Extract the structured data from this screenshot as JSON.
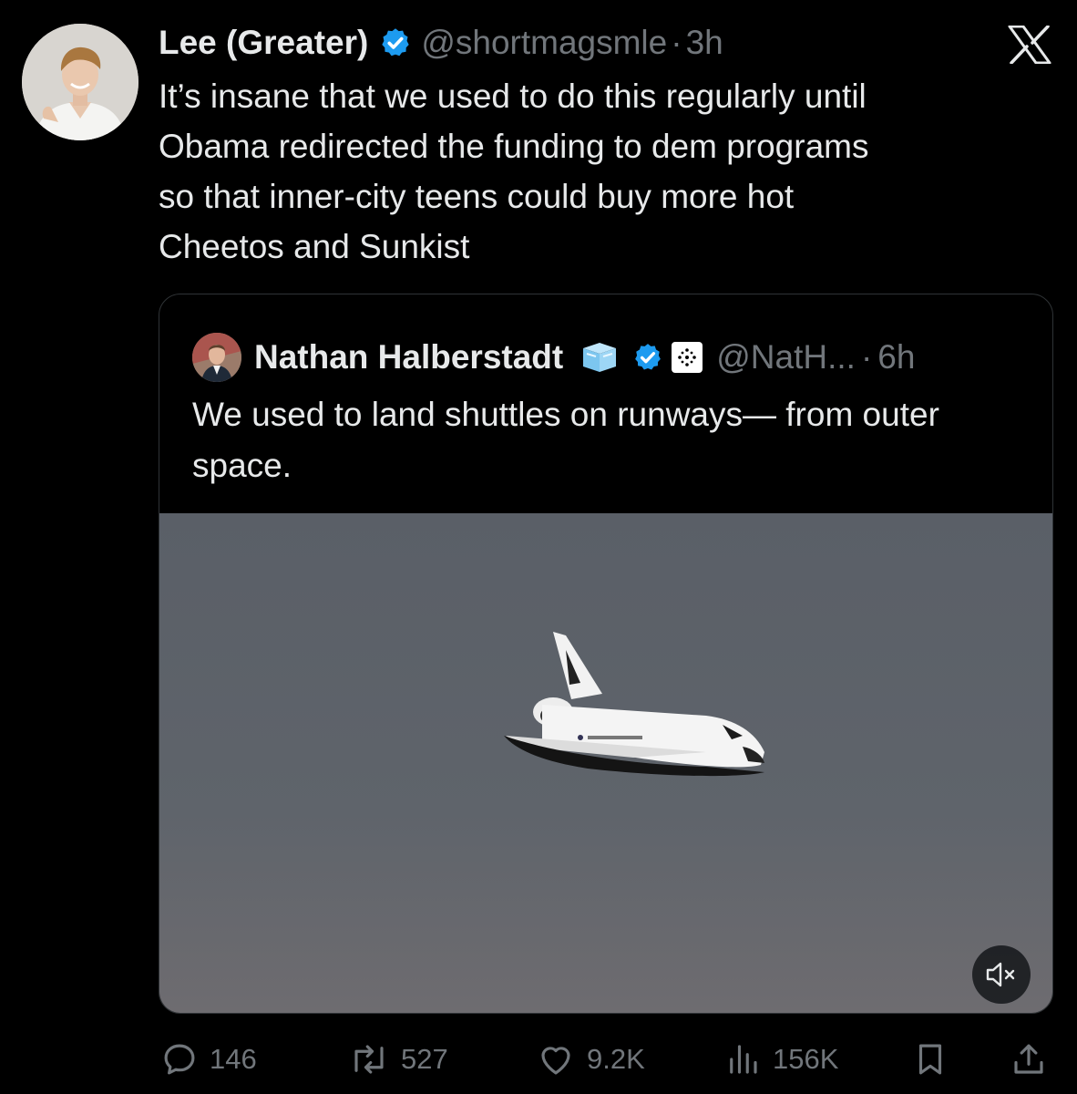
{
  "app": {
    "brand_icon": "x-logo-icon"
  },
  "tweet": {
    "author": {
      "name": "Lee (Greater)",
      "handle": "@shortmagsmle",
      "verified_color": "#1d9bf0"
    },
    "separator": "·",
    "time": "3h",
    "text": "It’s insane that we used to do this regularly until\nObama redirected the funding to dem programs\nso that inner-city teens could buy more hot\nCheetos and Sunkist"
  },
  "quoted": {
    "author": {
      "name": "Nathan Halberstadt",
      "handle": "@NatH...",
      "badges": [
        "ice-cube-emoji-icon",
        "verified-badge-icon",
        "organization-badge-icon"
      ]
    },
    "separator": "·",
    "time": "6h",
    "text": "We used to land shuttles on runways— from outer space.",
    "media": {
      "type": "video",
      "description_icon": "space-shuttle-image",
      "muted": true,
      "mute_icon": "speaker-muted-icon"
    }
  },
  "actions": {
    "reply": {
      "icon": "reply-icon",
      "count": "146"
    },
    "repost": {
      "icon": "repost-icon",
      "count": "527"
    },
    "like": {
      "icon": "heart-icon",
      "count": "9.2K"
    },
    "views": {
      "icon": "views-icon",
      "count": "156K"
    },
    "bookmark": {
      "icon": "bookmark-icon"
    },
    "share": {
      "icon": "share-icon"
    }
  },
  "colors": {
    "background": "#000000",
    "text": "#e7e9ea",
    "muted_text": "#71767b",
    "border": "#2f3336",
    "accent": "#1d9bf0",
    "sky": "#5d636b"
  }
}
